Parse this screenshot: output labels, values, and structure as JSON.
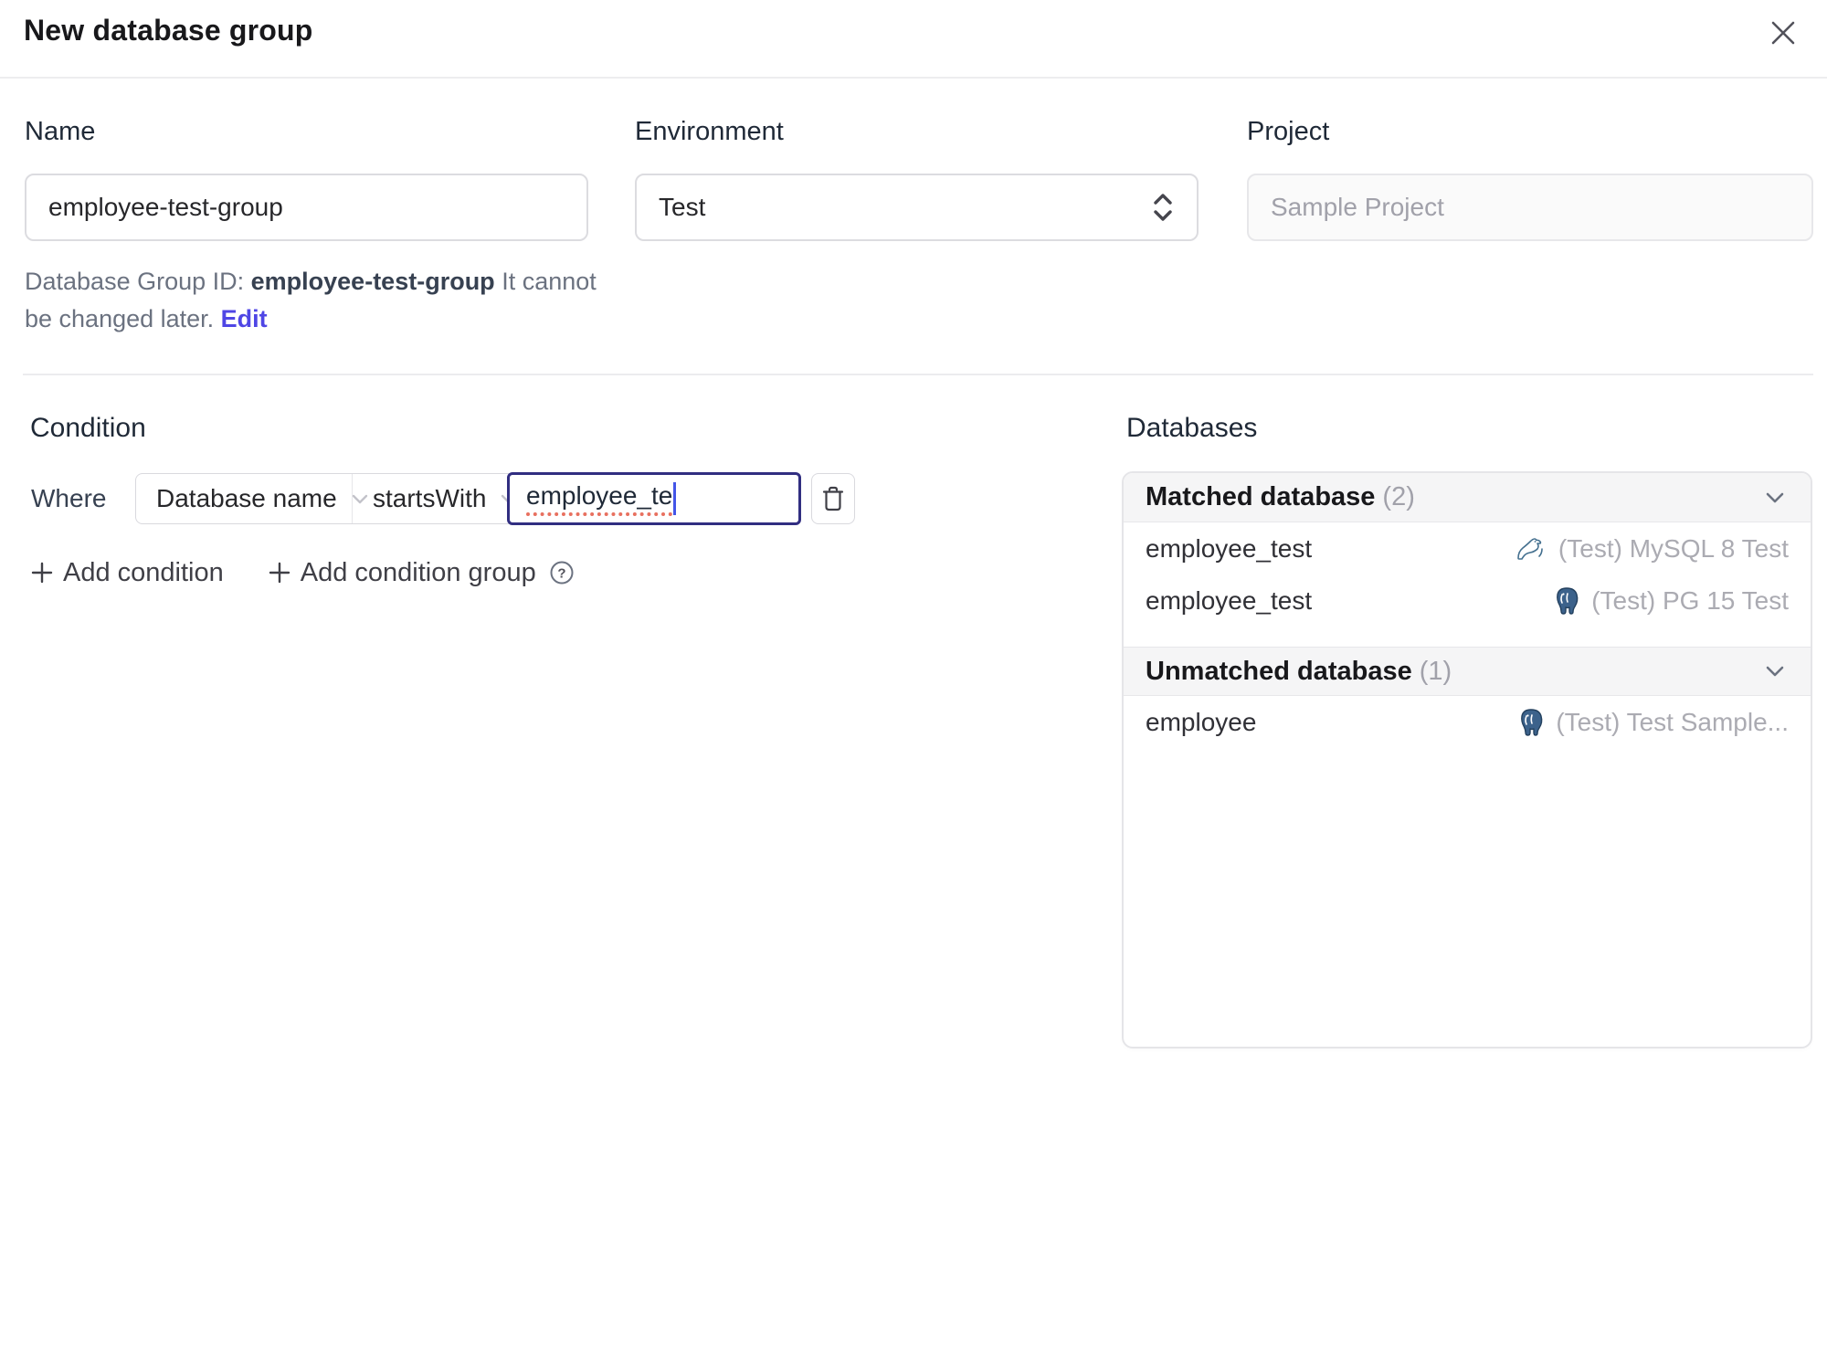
{
  "header": {
    "title": "New database group"
  },
  "form": {
    "name": {
      "label": "Name",
      "value": "employee-test-group"
    },
    "environment": {
      "label": "Environment",
      "value": "Test"
    },
    "project": {
      "label": "Project",
      "value": "Sample Project"
    },
    "id_note": {
      "prefix": "Database Group ID: ",
      "id": "employee-test-group",
      "suffix": " It cannot be changed later. ",
      "edit": "Edit"
    }
  },
  "condition": {
    "heading": "Condition",
    "where": "Where",
    "field": "Database name",
    "operator": "startsWith",
    "value": "employee_te",
    "add_condition": "Add condition",
    "add_condition_group": "Add condition group"
  },
  "databases": {
    "heading": "Databases",
    "sections": [
      {
        "title": "Matched database",
        "count": "(2)",
        "rows": [
          {
            "name": "employee_test",
            "engine": "mysql",
            "instance": "(Test) MySQL 8 Test"
          },
          {
            "name": "employee_test",
            "engine": "postgresql",
            "instance": "(Test) PG 15 Test"
          }
        ]
      },
      {
        "title": "Unmatched database",
        "count": "(1)",
        "rows": [
          {
            "name": "employee",
            "engine": "postgresql",
            "instance": "(Test) Test Sample..."
          }
        ]
      }
    ]
  },
  "colors": {
    "accent_indigo": "#4f46e5",
    "focus_border": "#312e81",
    "header_bg": "#f5f5f6",
    "border": "#e5e5e8",
    "muted_text": "#a1a1aa",
    "spellcheck_red": "#e8705f"
  }
}
